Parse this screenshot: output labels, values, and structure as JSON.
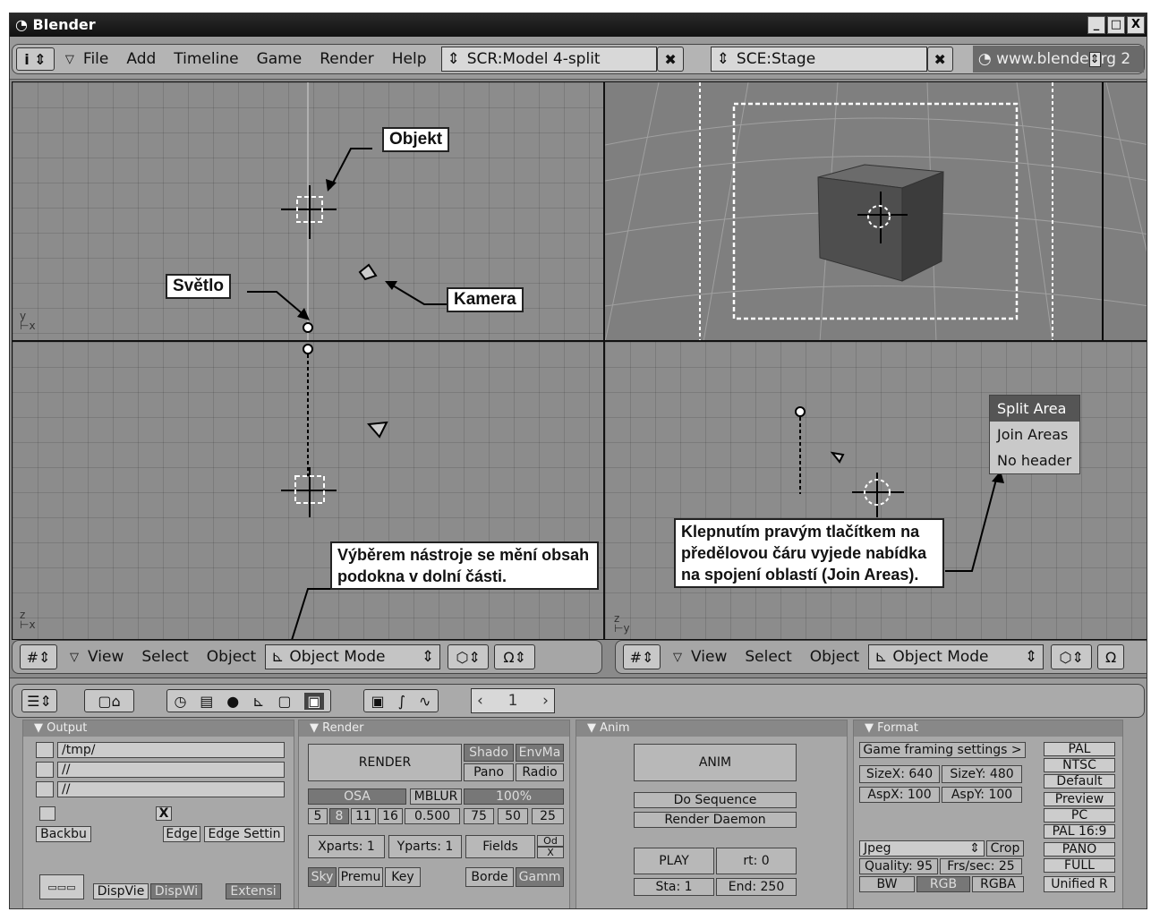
{
  "window": {
    "title": "Blender"
  },
  "header": {
    "menus": [
      "File",
      "Add",
      "Timeline",
      "Game",
      "Render",
      "Help"
    ],
    "screen": "SCR:Model 4-split",
    "scene": "SCE:Stage",
    "url": "www.blende",
    "url_tail": "rg 2"
  },
  "labels": {
    "objekt": "Objekt",
    "svetlo": "Světlo",
    "kamera": "Kamera",
    "tool_note": "Výběrem nástroje se mění obsah podokna v dolní části.",
    "join_note": "Klepnutím pravým tlačítkem na předělovou čáru vyjede nabídka na spojení oblastí (Join Areas)."
  },
  "context_menu": {
    "items": [
      "Split Area",
      "Join Areas",
      "No header"
    ]
  },
  "viewport_header": {
    "view": "View",
    "select": "Select",
    "object": "Object",
    "mode": "Object Mode"
  },
  "axes": {
    "tl": "y",
    "tl2": "x",
    "bl": "z",
    "bl2": "x",
    "br": "z",
    "br2": "y"
  },
  "buttons_window": {
    "frame": "1",
    "output": {
      "title": "Output",
      "path1": "/tmp/",
      "path2": "//",
      "path3": "//",
      "backbuf": "Backbu",
      "edge": "Edge",
      "edge_settings": "Edge Settin",
      "dispview": "DispVie",
      "dispwin": "DispWi",
      "extensions": "Extensi",
      "x": "X"
    },
    "render": {
      "title": "Render",
      "render": "RENDER",
      "shadow": "Shado",
      "envmap": "EnvMa",
      "pano": "Pano",
      "radio": "Radio",
      "osa": "OSA",
      "mblur": "MBLUR",
      "percent": "100%",
      "osa_vals": [
        "5",
        "8",
        "11",
        "16"
      ],
      "blur": "0.500",
      "pcts": [
        "75",
        "50",
        "25"
      ],
      "xparts": "Xparts: 1",
      "yparts": "Yparts: 1",
      "fields": "Fields",
      "odd": "Od",
      "oddx": "X",
      "sky": "Sky",
      "premul": "Premu",
      "key": "Key",
      "border": "Borde",
      "gamma": "Gamm"
    },
    "anim": {
      "title": "Anim",
      "anim": "ANIM",
      "do_sequence": "Do Sequence",
      "render_daemon": "Render Daemon",
      "play": "PLAY",
      "rt": "rt: 0",
      "sta": "Sta: 1",
      "end": "End: 250"
    },
    "format": {
      "title": "Format",
      "game_framing": "Game framing settings >",
      "sizex": "SizeX: 640",
      "sizey": "SizeY: 480",
      "aspx": "AspX: 100",
      "aspy": "AspY: 100",
      "format": "Jpeg",
      "crop": "Crop",
      "quality": "Quality: 95",
      "fps": "Frs/sec: 25",
      "bw": "BW",
      "rgb": "RGB",
      "rgba": "RGBA",
      "presets": [
        "PAL",
        "NTSC",
        "Default",
        "Preview",
        "PC",
        "PAL 16:9",
        "PANO",
        "FULL",
        "Unified R"
      ]
    }
  }
}
